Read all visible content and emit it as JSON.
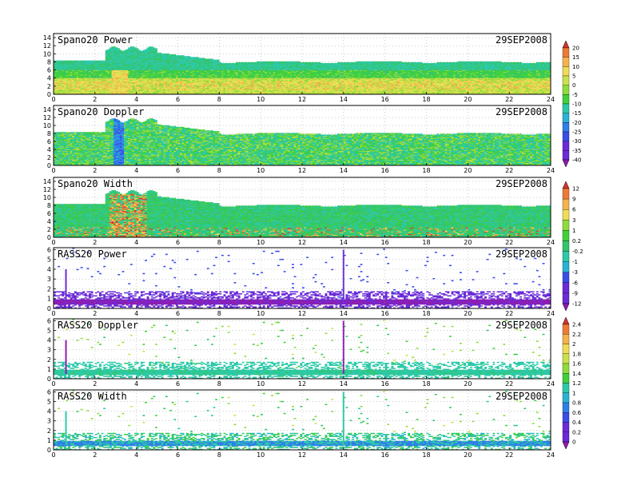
{
  "chart_data": [
    {
      "type": "heatmap",
      "title": "Spano20 Power",
      "date": "29SEP2008",
      "x": {
        "range": [
          0,
          24
        ],
        "ticks": [
          0,
          2,
          4,
          6,
          8,
          10,
          12,
          14,
          16,
          18,
          20,
          22,
          24
        ]
      },
      "y": {
        "range": [
          0,
          15
        ],
        "ticks": [
          0,
          2,
          4,
          6,
          8,
          10,
          12,
          14
        ]
      },
      "colorbar": {
        "id": "cb1",
        "levels": [
          "20",
          "15",
          "10",
          "5",
          "0",
          "-5",
          "-10",
          "-15",
          "-20",
          "-25",
          "-30",
          "-35",
          "-40"
        ]
      },
      "grid": true
    },
    {
      "type": "heatmap",
      "title": "Spano20 Doppler",
      "date": "29SEP2008",
      "x": {
        "range": [
          0,
          24
        ],
        "ticks": [
          0,
          2,
          4,
          6,
          8,
          10,
          12,
          14,
          16,
          18,
          20,
          22,
          24
        ]
      },
      "y": {
        "range": [
          0,
          15
        ],
        "ticks": [
          0,
          2,
          4,
          6,
          8,
          10,
          12,
          14
        ]
      },
      "colorbar": "cb1",
      "grid": true
    },
    {
      "type": "heatmap",
      "title": "Spano20 Width",
      "date": "29SEP2008",
      "x": {
        "range": [
          0,
          24
        ],
        "ticks": [
          0,
          2,
          4,
          6,
          8,
          10,
          12,
          14,
          16,
          18,
          20,
          22,
          24
        ]
      },
      "y": {
        "range": [
          0,
          15
        ],
        "ticks": [
          0,
          2,
          4,
          6,
          8,
          10,
          12,
          14
        ]
      },
      "colorbar": {
        "id": "cb2",
        "levels": [
          "12",
          "9",
          "6",
          "3",
          "1",
          "0.2",
          "-0.2",
          "-1",
          "-3",
          "-6",
          "-9",
          "-12"
        ]
      },
      "grid": true
    },
    {
      "type": "heatmap",
      "title": "RASS20 Power",
      "date": "29SEP2008",
      "x": {
        "range": [
          0,
          24
        ],
        "ticks": [
          0,
          2,
          4,
          6,
          8,
          10,
          12,
          14,
          16,
          18,
          20,
          22,
          24
        ]
      },
      "y": {
        "range": [
          0,
          6.2
        ],
        "ticks": [
          0,
          1,
          2,
          3,
          4,
          5,
          6
        ]
      },
      "colorbar": "cb2",
      "grid": true
    },
    {
      "type": "heatmap",
      "title": "RASS20 Doppler",
      "date": "29SEP2008",
      "x": {
        "range": [
          0,
          24
        ],
        "ticks": [
          0,
          2,
          4,
          6,
          8,
          10,
          12,
          14,
          16,
          18,
          20,
          22,
          24
        ]
      },
      "y": {
        "range": [
          0,
          6.2
        ],
        "ticks": [
          0,
          1,
          2,
          3,
          4,
          5,
          6
        ]
      },
      "colorbar": {
        "id": "cb3",
        "levels": [
          "2.4",
          "2.2",
          "2",
          "1.8",
          "1.6",
          "1.4",
          "1.2",
          "1",
          "0.8",
          "0.6",
          "0.4",
          "0.2",
          "0"
        ]
      },
      "grid": true
    },
    {
      "type": "heatmap",
      "title": "RASS20 Width",
      "date": "29SEP2008",
      "x": {
        "range": [
          0,
          24
        ],
        "ticks": [
          0,
          2,
          4,
          6,
          8,
          10,
          12,
          14,
          16,
          18,
          20,
          22,
          24
        ]
      },
      "y": {
        "range": [
          0,
          6.2
        ],
        "ticks": [
          0,
          1,
          2,
          3,
          4,
          5,
          6
        ]
      },
      "colorbar": "cb3",
      "grid": true
    }
  ],
  "colormap": [
    "#8e1cb0",
    "#6a2bd8",
    "#3a4de8",
    "#2f7fe8",
    "#29b3d6",
    "#2cc9a9",
    "#32c66a",
    "#3fd13a",
    "#8fdc3a",
    "#c9e24a",
    "#f0dc55",
    "#f6b24a",
    "#ef7a36",
    "#d8332c"
  ]
}
